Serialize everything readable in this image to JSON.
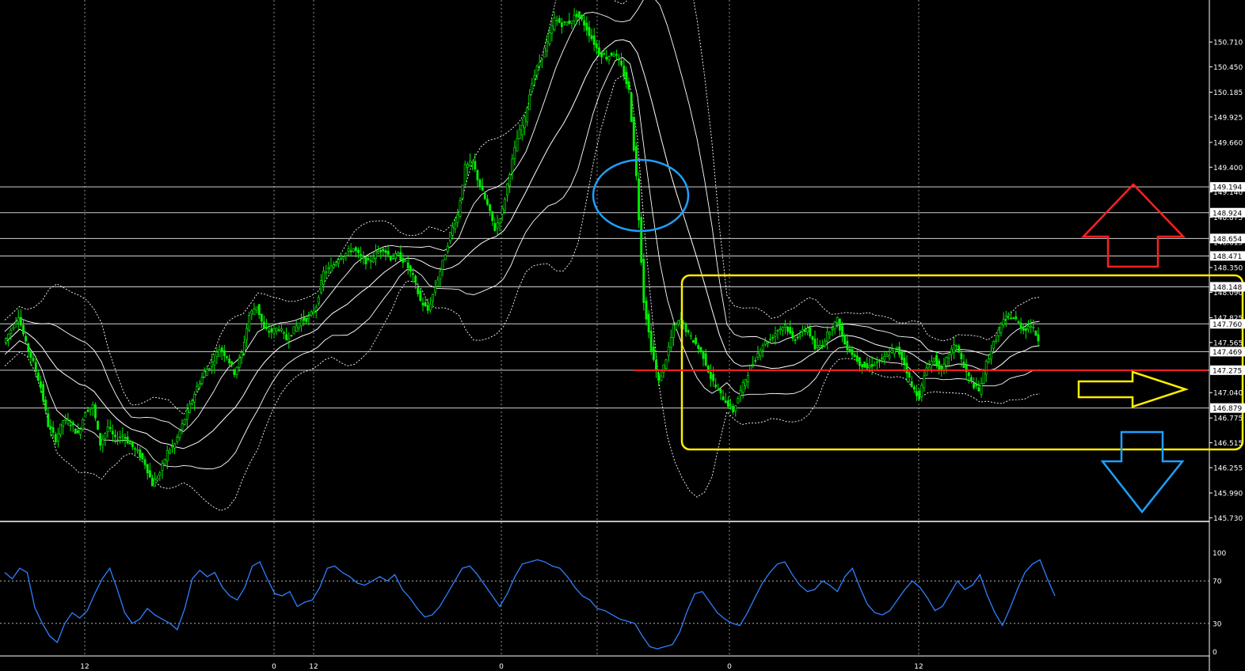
{
  "colors": {
    "background": "#000000",
    "candle": "#00ee00",
    "band": "#ffffff",
    "grid": "#b4b4b4",
    "level_line": "#d0d0d0",
    "axis_text": "#ffffff",
    "tag_bg": "#ffffff",
    "tag_text": "#000000",
    "oscillator": "#2f7fff",
    "circle": "#1ea0ff",
    "range_box": "#ffee00",
    "red_line": "#ff2020",
    "up_arrow": "#ff2020",
    "side_arrow": "#ffee00",
    "down_arrow": "#1ea0ff"
  },
  "chart_data": [
    {
      "type": "candlestick",
      "panel": "price",
      "yaxis": {
        "ylim": [
          145.7,
          151.15
        ],
        "tick_labels": [
          "150.710",
          "150.450",
          "150.185",
          "149.925",
          "149.660",
          "149.400",
          "149.140",
          "148.875",
          "148.615",
          "148.350",
          "148.090",
          "147.825",
          "147.565",
          "147.040",
          "146.775",
          "146.515",
          "146.255",
          "145.990",
          "145.730"
        ]
      },
      "xaxis": {
        "tick_labels": [
          "12",
          "0",
          "12",
          "0",
          "0",
          "12"
        ],
        "tick_positions_bar": [
          15,
          50,
          55,
          80,
          102,
          130
        ]
      },
      "level_lines": [
        {
          "price": 149.194,
          "label": "149.194"
        },
        {
          "price": 148.924,
          "label": "148.924"
        },
        {
          "price": 148.654,
          "label": "148.654"
        },
        {
          "price": 148.471,
          "label": "148.471"
        },
        {
          "price": 148.148,
          "label": "148.148"
        },
        {
          "price": 147.76,
          "label": "147.760"
        },
        {
          "price": 147.469,
          "label": "147.469"
        },
        {
          "price": 147.275,
          "label": "147.275"
        },
        {
          "price": 146.879,
          "label": "146.879"
        }
      ],
      "closes": [
        147.56,
        147.7,
        147.85,
        147.55,
        147.35,
        147.1,
        146.7,
        146.55,
        146.75,
        146.72,
        146.6,
        146.85,
        146.9,
        146.5,
        146.68,
        146.55,
        146.6,
        146.5,
        146.42,
        146.3,
        146.08,
        146.2,
        146.42,
        146.5,
        146.7,
        146.9,
        147.1,
        147.25,
        147.35,
        147.5,
        147.42,
        147.25,
        147.45,
        147.85,
        147.95,
        147.7,
        147.68,
        147.72,
        147.6,
        147.7,
        147.8,
        147.82,
        147.95,
        148.3,
        148.35,
        148.45,
        148.5,
        148.55,
        148.45,
        148.4,
        148.5,
        148.55,
        148.45,
        148.48,
        148.4,
        148.25,
        148.0,
        147.9,
        148.15,
        148.4,
        148.7,
        148.9,
        149.4,
        149.45,
        149.2,
        149.0,
        148.75,
        148.95,
        149.35,
        149.7,
        149.9,
        150.3,
        150.5,
        150.7,
        150.95,
        150.9,
        150.92,
        151.0,
        150.9,
        150.75,
        150.6,
        150.55,
        150.6,
        150.45,
        150.2,
        149.3,
        148.0,
        147.5,
        147.15,
        147.4,
        147.72,
        147.8,
        147.65,
        147.55,
        147.42,
        147.2,
        147.05,
        146.95,
        146.85,
        147.05,
        147.25,
        147.4,
        147.55,
        147.6,
        147.7,
        147.75,
        147.6,
        147.65,
        147.72,
        147.5,
        147.55,
        147.7,
        147.8,
        147.55,
        147.45,
        147.35,
        147.3,
        147.35,
        147.38,
        147.45,
        147.5,
        147.35,
        147.1,
        147.0,
        147.3,
        147.4,
        147.25,
        147.45,
        147.55,
        147.3,
        147.15,
        147.05,
        147.35,
        147.55,
        147.75,
        147.85,
        147.8,
        147.7,
        147.75,
        147.6
      ],
      "bollinger": {
        "period": 12,
        "inner_dev": 1.0,
        "outer_dev": 2.0
      }
    },
    {
      "type": "line",
      "panel": "oscillator",
      "ylim": [
        0,
        100
      ],
      "levels": [
        30,
        70
      ],
      "tick_labels": [
        "100",
        "70",
        "30",
        "0"
      ],
      "values": [
        78,
        72,
        82,
        78,
        45,
        30,
        18,
        12,
        30,
        40,
        35,
        42,
        58,
        72,
        82,
        62,
        40,
        30,
        34,
        44,
        38,
        34,
        30,
        24,
        44,
        72,
        80,
        74,
        78,
        64,
        56,
        52,
        64,
        84,
        88,
        72,
        58,
        56,
        60,
        46,
        50,
        52,
        64,
        82,
        84,
        78,
        74,
        68,
        66,
        70,
        74,
        70,
        76,
        62,
        54,
        44,
        36,
        38,
        46,
        58,
        70,
        82,
        84,
        76,
        66,
        56,
        46,
        58,
        74,
        86,
        88,
        90,
        88,
        84,
        82,
        74,
        64,
        56,
        52,
        44,
        42,
        38,
        34,
        32,
        30,
        18,
        8,
        6,
        8,
        10,
        22,
        42,
        58,
        60,
        50,
        40,
        34,
        30,
        28,
        40,
        54,
        68,
        78,
        86,
        88,
        76,
        66,
        60,
        62,
        70,
        66,
        60,
        74,
        82,
        64,
        48,
        40,
        38,
        42,
        52,
        62,
        70,
        64,
        54,
        42,
        46,
        58,
        70,
        62,
        66,
        76,
        56,
        40,
        28,
        44,
        62,
        78,
        86,
        90,
        72,
        56
      ]
    }
  ],
  "annotations": {
    "circle": "blue ellipse around sharp drop",
    "range_box": "yellow rounded rectangle around consolidation",
    "horizontal_red_line_price": 147.275,
    "arrows": [
      "up",
      "right",
      "down"
    ]
  }
}
